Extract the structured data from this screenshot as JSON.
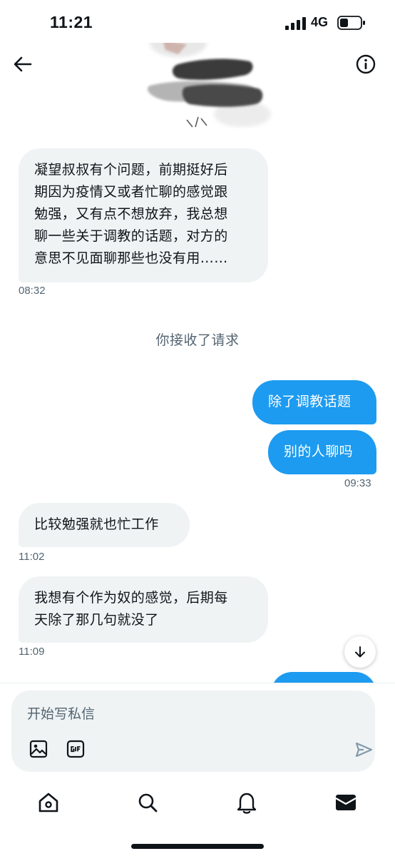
{
  "status_bar": {
    "time": "11:21",
    "network": "4G"
  },
  "header": {
    "back_icon": "arrow-left-icon",
    "info_icon": "info-icon",
    "avatar": "blurred-profile-image"
  },
  "messages": [
    {
      "direction": "in",
      "lines": [
        "凝望叔叔有个问题，前期挺好后",
        "期因为疫情又或者忙聊的感觉跟",
        "勉强，又有点不想放弃，我总想",
        "聊一些关于调教的话题，对方的",
        "意思不见面聊那些也没有用……"
      ],
      "time": "08:32"
    },
    {
      "type": "system",
      "text": "你接收了请求"
    },
    {
      "direction": "out",
      "text": "除了调教话题"
    },
    {
      "direction": "out",
      "text": "别的人聊吗",
      "time": "09:33"
    },
    {
      "direction": "in",
      "text": "比较勉强就也忙工作",
      "time": "11:02"
    },
    {
      "direction": "in",
      "lines": [
        "我想有个作为奴的感觉，后期每",
        "天除了那几句就没了"
      ],
      "time": "11:09"
    }
  ],
  "composer": {
    "placeholder": "开始写私信"
  },
  "tab_bar": {
    "items": [
      "home-icon",
      "search-icon",
      "bell-icon",
      "mail-icon"
    ]
  },
  "colors": {
    "accent": "#1d9bf0",
    "bubble_in": "#eff3f4",
    "muted_text": "#536471"
  }
}
